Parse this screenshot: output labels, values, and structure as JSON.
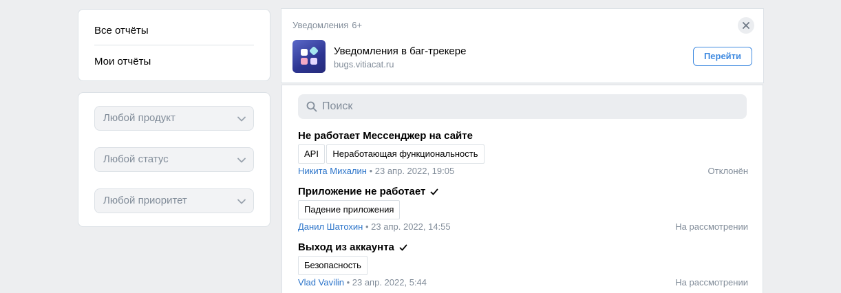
{
  "nav": {
    "all_reports": "Все отчёты",
    "my_reports": "Мои отчёты"
  },
  "filters": {
    "product": "Любой продукт",
    "status": "Любой статус",
    "priority": "Любой приоритет"
  },
  "notification": {
    "header": "Уведомления",
    "count": "6+",
    "app_title": "Уведомления в баг-трекере",
    "app_url": "bugs.vitiacat.ru",
    "go_label": "Перейти"
  },
  "search": {
    "placeholder": "Поиск"
  },
  "reports": [
    {
      "title": "Не работает Мессенджер на сайте",
      "tags": [
        "API",
        "Неработающая функциональность"
      ],
      "author": "Никита Михалин",
      "date": "• 23 апр. 2022, 19:05",
      "status": "Отклонён",
      "checked": false
    },
    {
      "title": "Приложение не работает",
      "tags": [
        "Падение приложения"
      ],
      "author": "Данил Шатохин",
      "date": "• 23 апр. 2022, 14:55",
      "status": "На рассмотрении",
      "checked": true
    },
    {
      "title": "Выход из аккаунта",
      "tags": [
        "Безопасность"
      ],
      "author": "Vlad Vavilin",
      "date": "• 23 апр. 2022, 5:44",
      "status": "На рассмотрении",
      "checked": true
    }
  ],
  "colors": {
    "accent": "#3f8ae0",
    "link": "#2a73c9",
    "muted": "#818c99",
    "background": "#edeef0"
  },
  "icons": [
    "close-icon",
    "chevron-down-icon",
    "search-icon",
    "check-icon",
    "app-icon"
  ]
}
